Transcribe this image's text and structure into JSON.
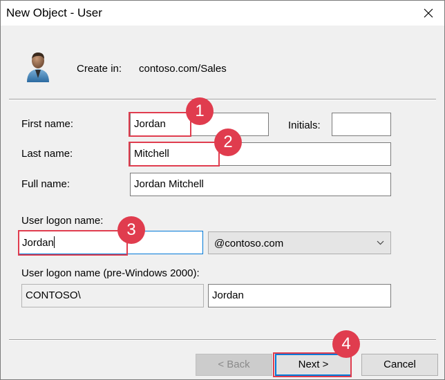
{
  "window": {
    "title": "New Object - User",
    "close_icon": "close-icon"
  },
  "header": {
    "icon": "user-icon",
    "create_in_label": "Create in:",
    "create_in_value": "contoso.com/Sales"
  },
  "form": {
    "first_name_label": "First name:",
    "first_name_value": "Jordan",
    "initials_label": "Initials:",
    "initials_value": "",
    "last_name_label": "Last name:",
    "last_name_value": "Mitchell",
    "full_name_label": "Full name:",
    "full_name_value": "Jordan Mitchell",
    "logon_name_label": "User logon name:",
    "logon_name_value": "Jordan",
    "domain_value": "@contoso.com",
    "pre2000_label": "User logon name (pre-Windows 2000):",
    "pre2000_domain": "CONTOSO\\",
    "pre2000_name": "Jordan"
  },
  "buttons": {
    "back_label": "< Back",
    "next_label": "Next >",
    "cancel_label": "Cancel"
  },
  "callouts": [
    "1",
    "2",
    "3",
    "4"
  ],
  "colors": {
    "highlight": "#e03c4e",
    "focus": "#0078d7",
    "dialog_bg": "#f0f0f0"
  }
}
